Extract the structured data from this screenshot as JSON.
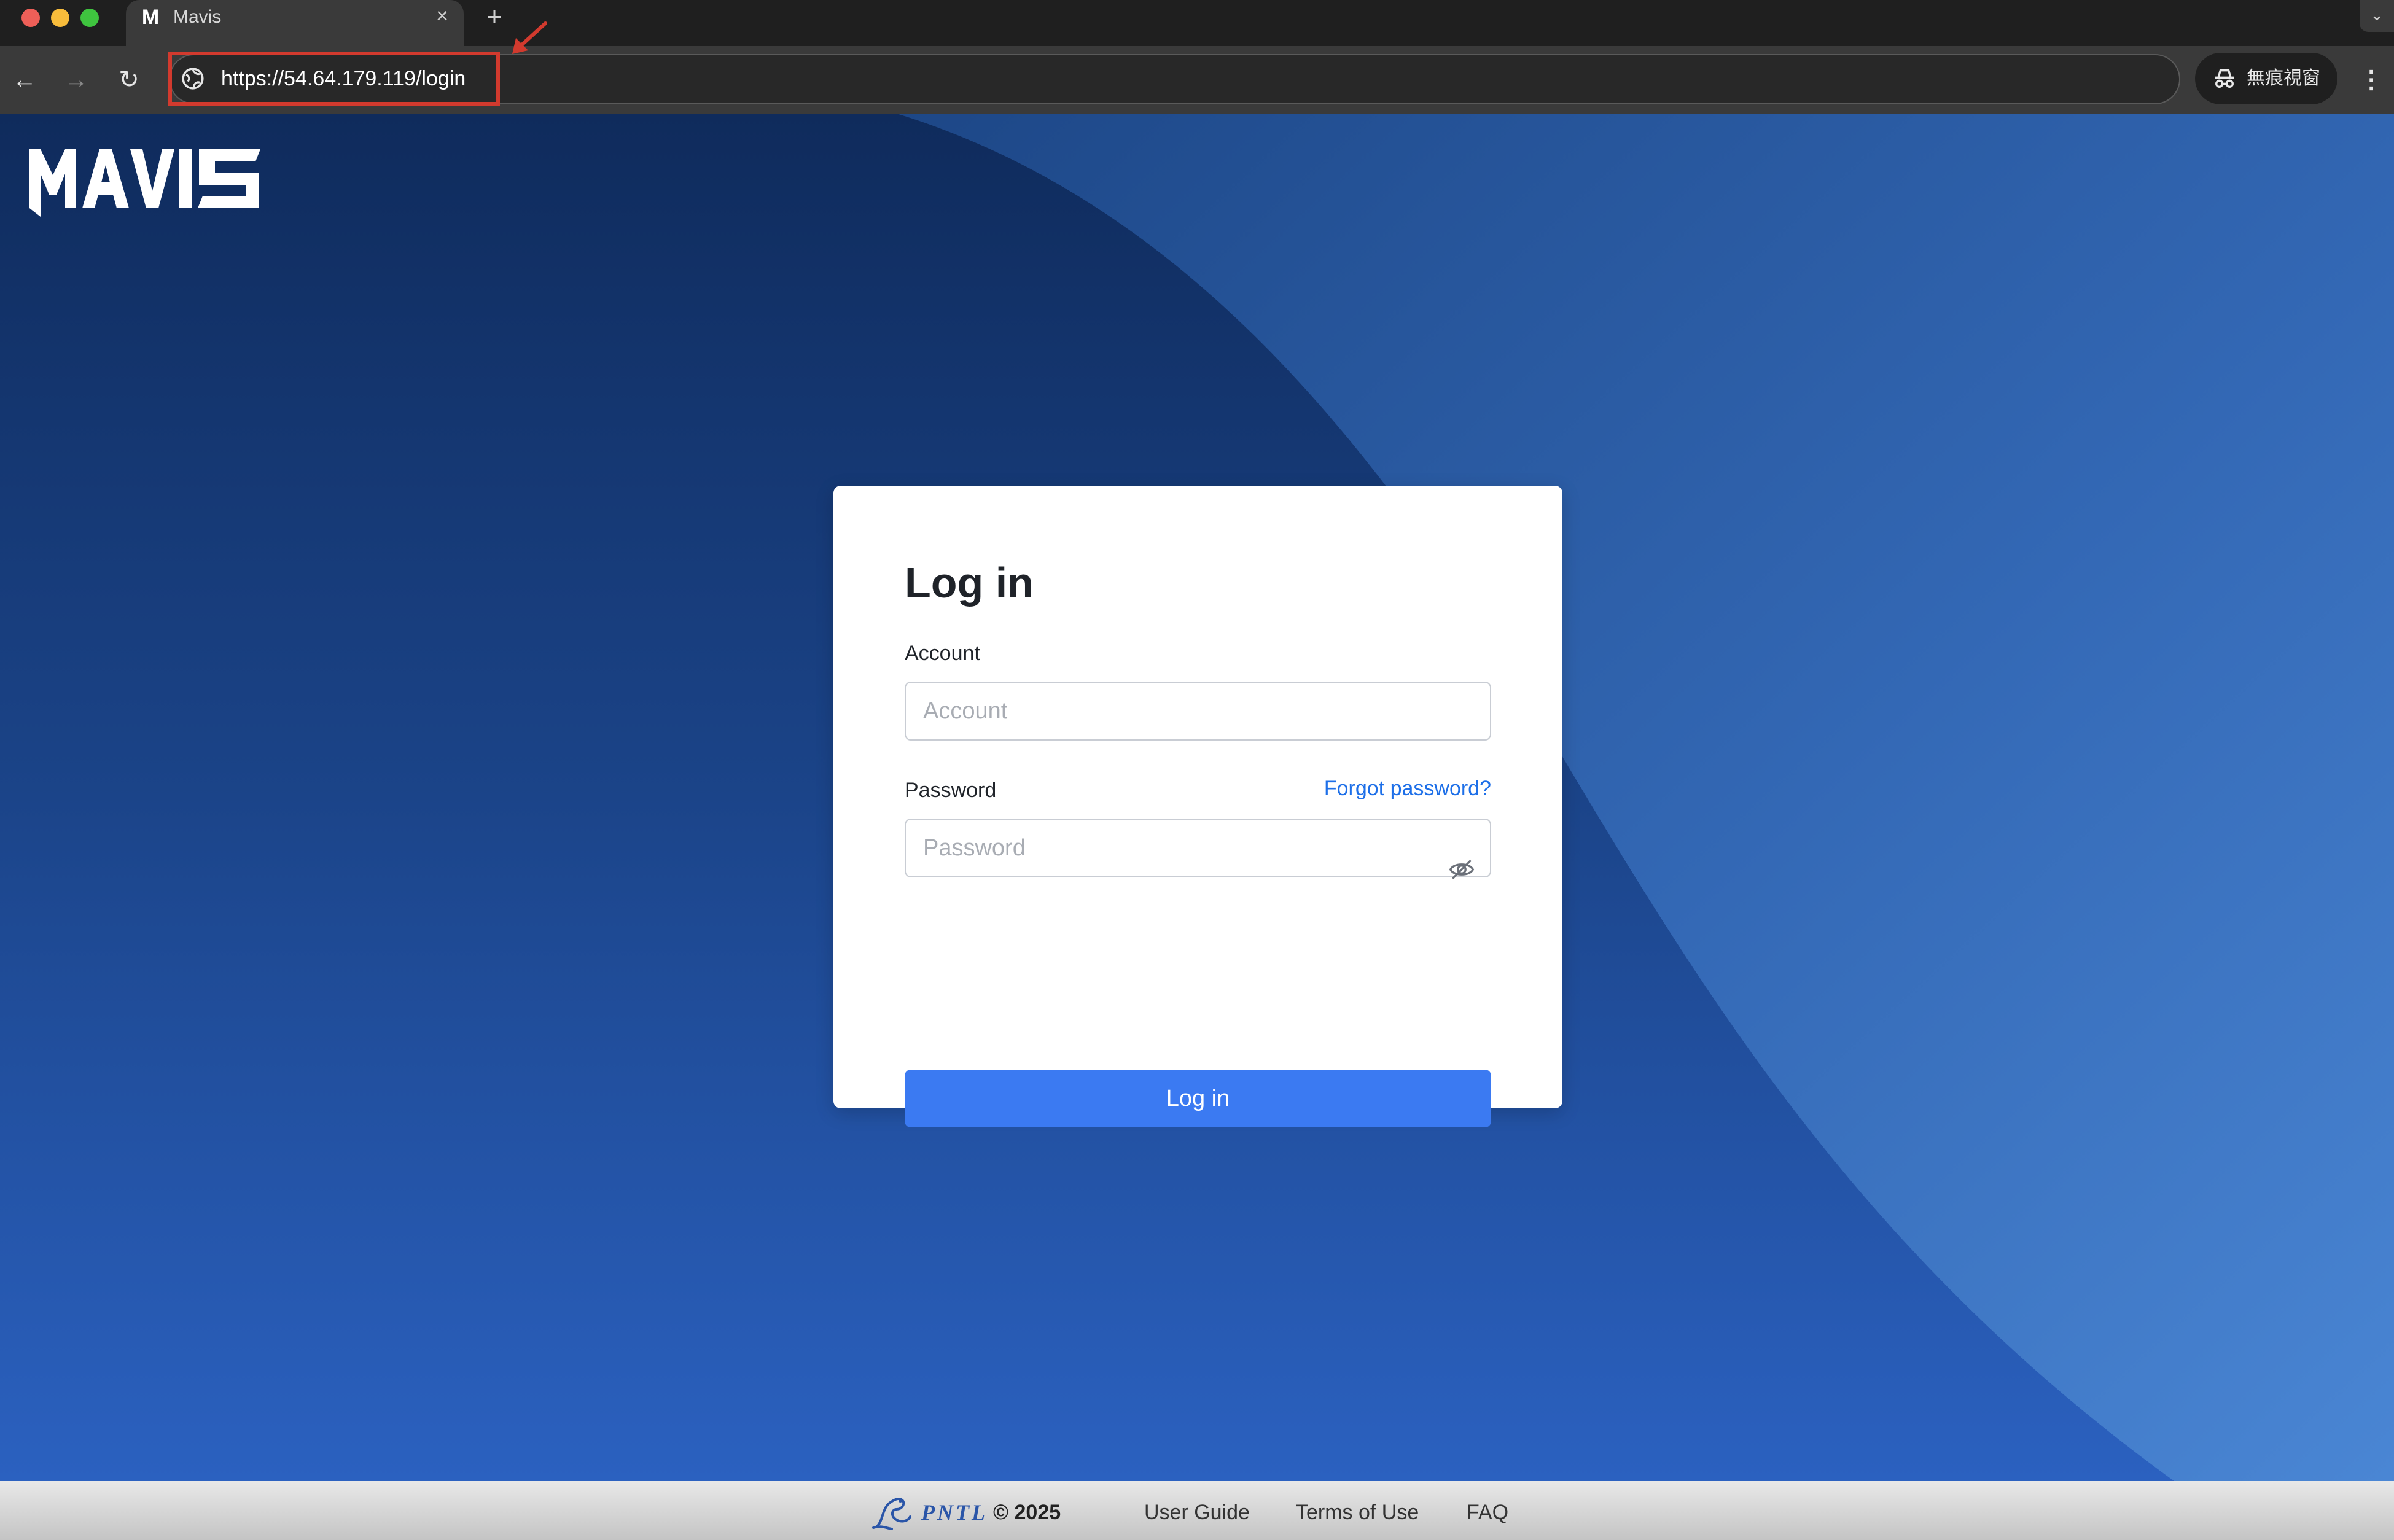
{
  "browser": {
    "tab_title": "Mavis",
    "tab_close": "×",
    "new_tab": "+",
    "url": "https://54.64.179.119/login",
    "incognito_label": "無痕視窗",
    "icons": {
      "back": "arrow-left-icon",
      "forward": "arrow-right-icon",
      "reload": "reload-icon",
      "site_info": "globe-icon",
      "menu": "more-vertical-icon"
    }
  },
  "annotation": {
    "highlight_color": "#d23a2e"
  },
  "page": {
    "logo_text": "MAVIS",
    "colors": {
      "primary": "#3b7af2",
      "link": "#1d6fe8",
      "background_dark": "#0f2b5c",
      "background_light": "#2b61c0"
    }
  },
  "login": {
    "title": "Log in",
    "account_label": "Account",
    "account_placeholder": "Account",
    "account_value": "",
    "password_label": "Password",
    "password_placeholder": "Password",
    "password_value": "",
    "forgot_password": "Forgot password?",
    "submit_label": "Log in"
  },
  "footer": {
    "brand": "PNTL",
    "copyright": "© 2025",
    "links": [
      "User Guide",
      "Terms of Use",
      "FAQ"
    ]
  }
}
